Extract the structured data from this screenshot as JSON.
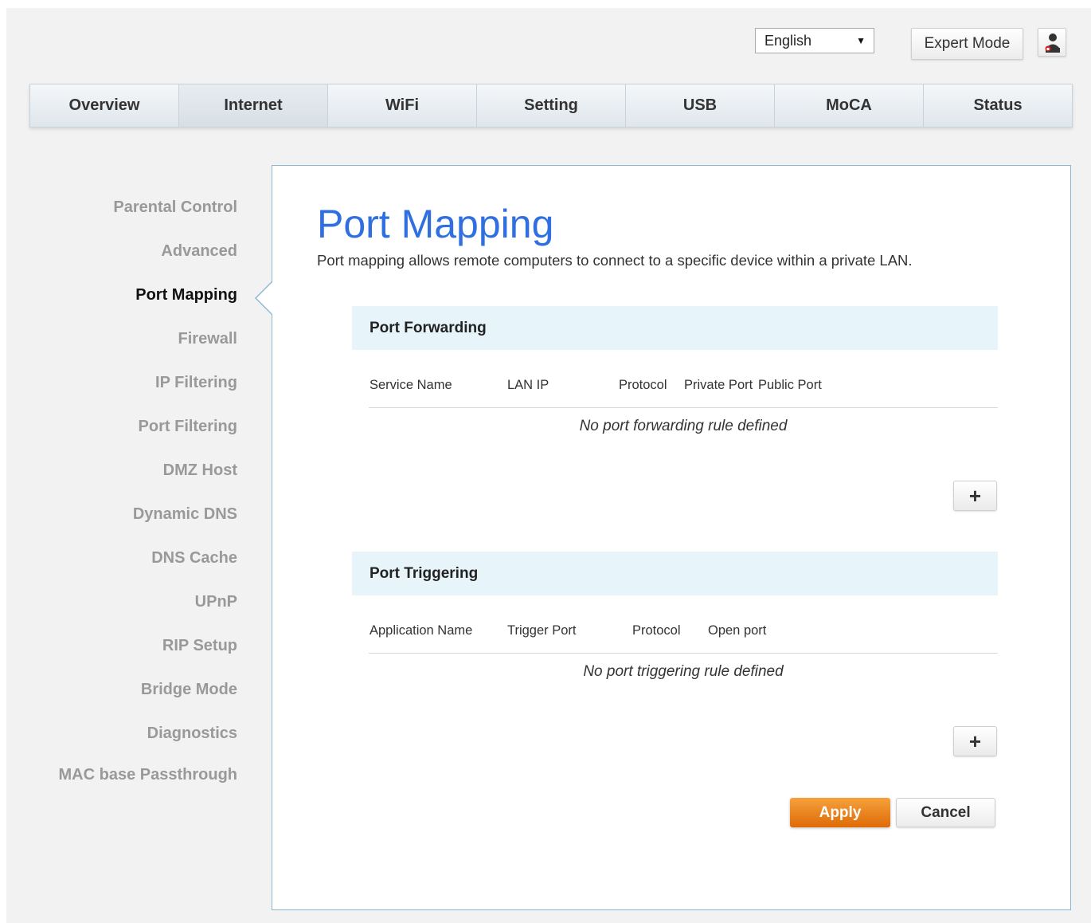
{
  "header": {
    "language": {
      "selected": "English"
    },
    "expert_mode_label": "Expert Mode",
    "user_icon": "user-icon",
    "caret_icon": "▼"
  },
  "main_nav": {
    "tabs": [
      {
        "label": "Overview"
      },
      {
        "label": "Internet",
        "active": true
      },
      {
        "label": "WiFi"
      },
      {
        "label": "Setting"
      },
      {
        "label": "USB"
      },
      {
        "label": "MoCA"
      },
      {
        "label": "Status"
      }
    ]
  },
  "sidebar": {
    "items": [
      {
        "label": "Parental Control"
      },
      {
        "label": "Advanced"
      },
      {
        "label": "Port Mapping",
        "active": true
      },
      {
        "label": "Firewall"
      },
      {
        "label": "IP Filtering"
      },
      {
        "label": "Port Filtering"
      },
      {
        "label": "DMZ Host"
      },
      {
        "label": "Dynamic DNS"
      },
      {
        "label": "DNS Cache"
      },
      {
        "label": "UPnP"
      },
      {
        "label": "RIP Setup"
      },
      {
        "label": "Bridge Mode"
      },
      {
        "label": "Diagnostics"
      },
      {
        "label": "MAC base Passthrough"
      }
    ]
  },
  "main": {
    "title": "Port Mapping",
    "description": "Port mapping allows remote computers to connect to a specific device within a private LAN.",
    "port_forwarding": {
      "heading": "Port Forwarding",
      "columns": [
        "Service Name",
        "LAN IP",
        "Protocol",
        "Private Port",
        "Public Port"
      ],
      "empty_message": "No port forwarding rule defined",
      "add_label": "+"
    },
    "port_triggering": {
      "heading": "Port Triggering",
      "columns": [
        "Application Name",
        "Trigger Port",
        "Protocol",
        "Open port"
      ],
      "empty_message": "No port triggering rule defined",
      "add_label": "+"
    },
    "apply_label": "Apply",
    "cancel_label": "Cancel"
  },
  "colors": {
    "title_blue": "#2f6fe0",
    "apply_orange": "#e87a12",
    "panel_border": "#8bb7d3",
    "section_bg": "#e7f4f9",
    "inactive_sidebar": "#999999"
  }
}
